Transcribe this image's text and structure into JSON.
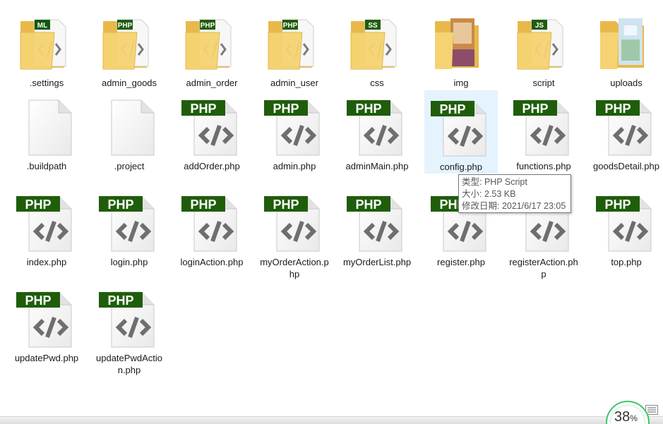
{
  "items": [
    {
      "name": ".settings",
      "type": "folder",
      "badge": "ML",
      "badge_color": "#0e5a0e"
    },
    {
      "name": "admin_goods",
      "type": "folder",
      "badge": "PHP",
      "badge_color": "#1f5d0b"
    },
    {
      "name": "admin_order",
      "type": "folder",
      "badge": "PHP",
      "badge_color": "#1f5d0b"
    },
    {
      "name": "admin_user",
      "type": "folder",
      "badge": "PHP",
      "badge_color": "#1f5d0b"
    },
    {
      "name": "css",
      "type": "folder",
      "badge": "SS",
      "badge_color": "#1f5d0b"
    },
    {
      "name": "img",
      "type": "folder-image"
    },
    {
      "name": "script",
      "type": "folder",
      "badge": "JS",
      "badge_color": "#1f5d0b"
    },
    {
      "name": "uploads",
      "type": "folder-image2"
    },
    {
      "name": ".buildpath",
      "type": "blank"
    },
    {
      "name": ".project",
      "type": "blank"
    },
    {
      "name": "addOrder.php",
      "type": "php"
    },
    {
      "name": "admin.php",
      "type": "php"
    },
    {
      "name": "adminMain.php",
      "type": "php"
    },
    {
      "name": "config.php",
      "type": "php",
      "selected": true
    },
    {
      "name": "functions.php",
      "type": "php"
    },
    {
      "name": "goodsDetail.php",
      "type": "php"
    },
    {
      "name": "index.php",
      "type": "php"
    },
    {
      "name": "login.php",
      "type": "php"
    },
    {
      "name": "loginAction.php",
      "type": "php"
    },
    {
      "name": "myOrderAction.php",
      "type": "php"
    },
    {
      "name": "myOrderList.php",
      "type": "php"
    },
    {
      "name": "register.php",
      "type": "php"
    },
    {
      "name": "registerAction.php",
      "type": "php"
    },
    {
      "name": "top.php",
      "type": "php"
    },
    {
      "name": "updatePwd.php",
      "type": "php"
    },
    {
      "name": "updatePwdAction.php",
      "type": "php"
    }
  ],
  "php_label": "PHP",
  "tooltip": {
    "type_line": "类型: PHP Script",
    "size_line": "大小: 2.53 KB",
    "date_line": "修改日期: 2021/6/17 23:05"
  },
  "speed_widget": {
    "value": "38",
    "unit": "%"
  },
  "colors": {
    "php_badge": "#1f5d0b",
    "folder": "#f5d372",
    "selection": "#e5f3ff",
    "speed_ring": "#3fc46a"
  }
}
